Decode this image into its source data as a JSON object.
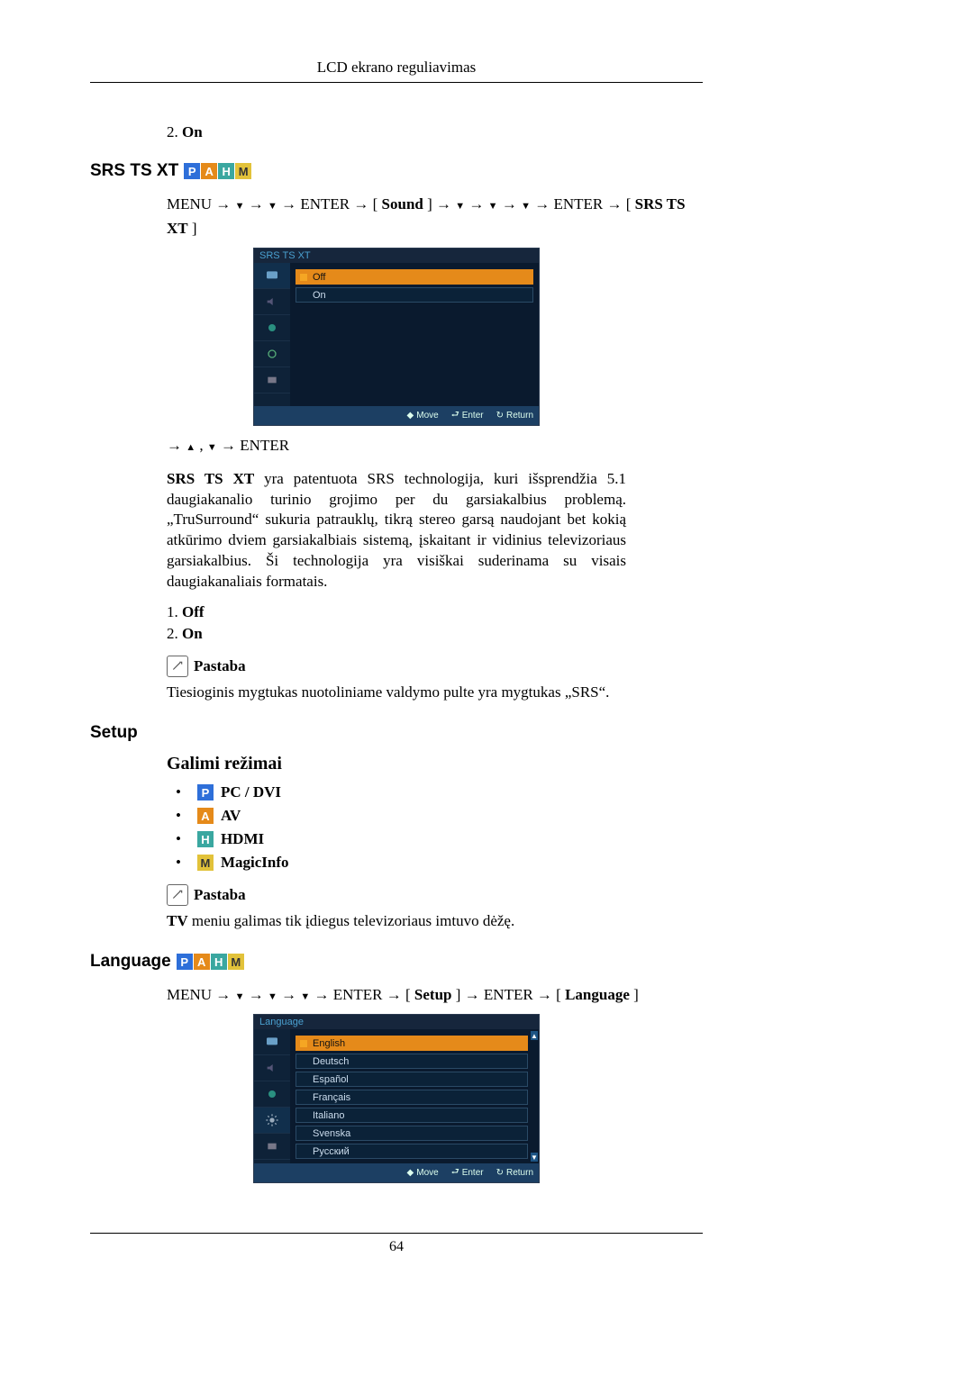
{
  "header": {
    "title": "LCD ekrano reguliavimas"
  },
  "intro_list": {
    "item2_num": "2.",
    "item2_label": "On"
  },
  "srs": {
    "heading": "SRS TS XT",
    "path_pre": "MENU → ",
    "path_mid1": " → ",
    "path_mid2": " → ENTER → [",
    "path_sound": "Sound",
    "path_mid3": "] →",
    "path_mid4": "→",
    "path_mid5": "→",
    "path_mid6": "→ ENTER → [",
    "path_target": "SRS TS XT",
    "path_end": "]",
    "osd_title": "SRS TS XT",
    "osd_opts": [
      "Off",
      "On"
    ],
    "osd_foot_move": "Move",
    "osd_foot_enter": "Enter",
    "osd_foot_return": "Return",
    "nav_line_pre": "→ ",
    "nav_line_mid": " , ",
    "nav_line_end": " → ENTER",
    "desc_pre": "SRS TS XT",
    "desc": " yra patentuota SRS technologija, kuri išsprendžia 5.1 daugiakanalio turinio grojimo per du garsiakalbius problemą. „TruSurround“ sukuria patrauklų, tikrą stereo garsą naudojant bet kokią atkūrimo dviem garsiakalbiais sistemą, įskaitant ir vidinius televizoriaus garsiakalbius. Ši technologija yra visiškai suderinama su visais daugiakanaliais formatais.",
    "li1_num": "1.",
    "li1_label": "Off",
    "li2_num": "2.",
    "li2_label": "On",
    "note_label": "Pastaba",
    "note_text": "Tiesioginis mygtukas nuotoliniame valdymo pulte yra mygtukas „SRS“."
  },
  "setup": {
    "heading": "Setup",
    "modes_heading": "Galimi režimai",
    "modes": [
      {
        "letter": "P",
        "cls": "b-p",
        "label": "PC / DVI"
      },
      {
        "letter": "A",
        "cls": "b-a",
        "label": "AV"
      },
      {
        "letter": "H",
        "cls": "b-h",
        "label": "HDMI"
      },
      {
        "letter": "M",
        "cls": "b-m",
        "label": "MagicInfo"
      }
    ],
    "note_label": "Pastaba",
    "note_pre": "TV",
    "note_text": " meniu galimas tik įdiegus televizoriaus imtuvo dėžę."
  },
  "language": {
    "heading": "Language",
    "path_pre": "MENU → ",
    "path_mid1": " → ",
    "path_mid2": " → ",
    "path_mid3": " → ENTER → [",
    "path_setup": "Setup",
    "path_mid4": "] → ENTER → [",
    "path_target": "Language",
    "path_end": " ]",
    "osd_title": "Language",
    "osd_opts": [
      "English",
      "Deutsch",
      "Español",
      "Français",
      "Italiano",
      "Svenska",
      "Русский"
    ],
    "osd_foot_move": "Move",
    "osd_foot_enter": "Enter",
    "osd_foot_return": "Return"
  },
  "footer": {
    "page": "64"
  }
}
